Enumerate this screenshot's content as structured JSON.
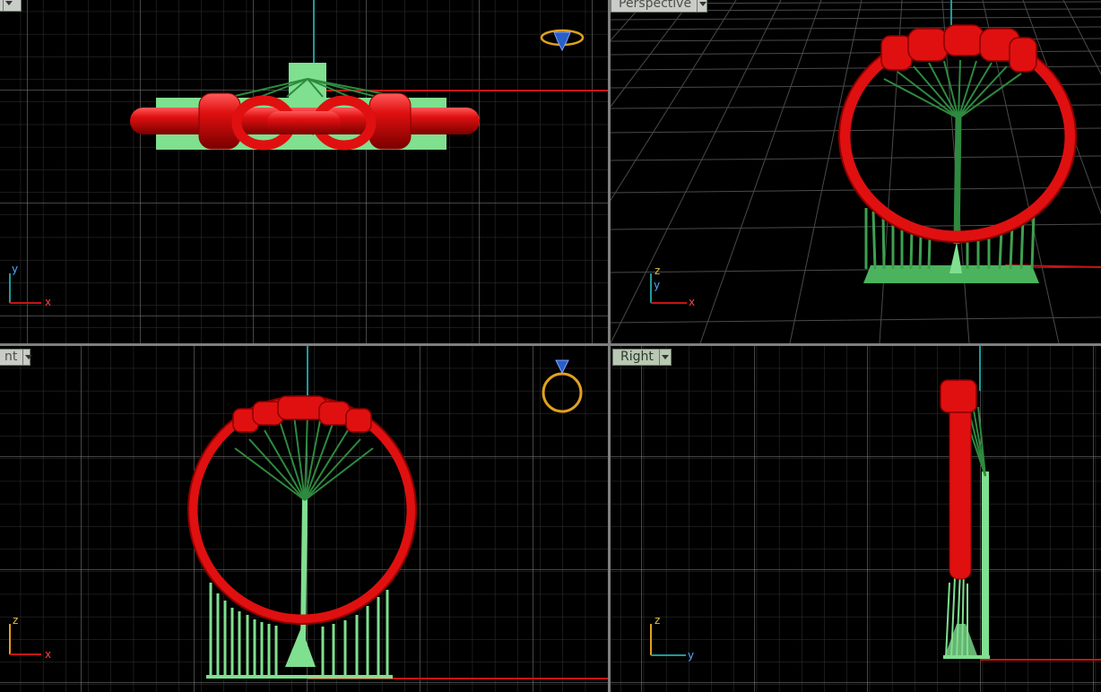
{
  "viewports": {
    "top": {
      "label": "",
      "axis": {
        "vertical": "y",
        "horizontal": "x"
      }
    },
    "perspective": {
      "label": "Perspective",
      "axis": {
        "vertical_upper": "z",
        "vertical_lower": "y",
        "horizontal": "x"
      }
    },
    "front": {
      "label": "nt",
      "axis": {
        "vertical": "z",
        "horizontal": "x"
      }
    },
    "right": {
      "label": "Right",
      "axis": {
        "vertical": "z",
        "horizontal": "y"
      }
    }
  },
  "colors": {
    "background": "#000000",
    "grid_minor": "#3a3a3a",
    "grid_major": "#8a8a8a",
    "axis_x": "#c81414",
    "axis_y": "#1f9a9a",
    "ring": "#e01010",
    "supports": "#2e8a3e",
    "supports_light": "#7fe08f",
    "label_bg": "#b9c9b4"
  },
  "icons": [
    "ring-gizmo-icon",
    "dropdown-icon"
  ]
}
